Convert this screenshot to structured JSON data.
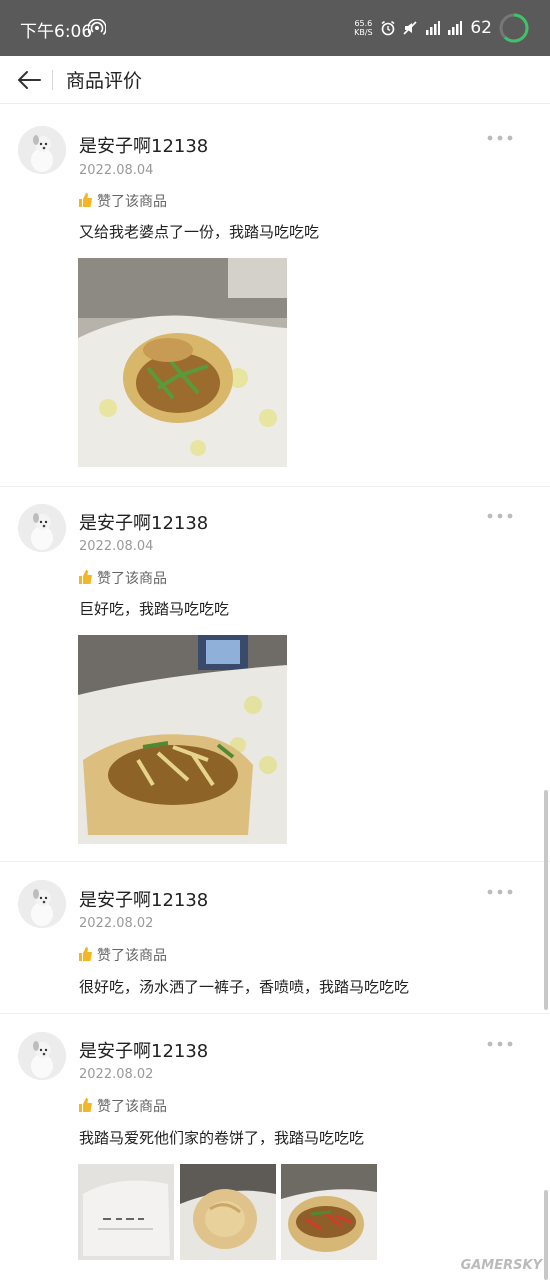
{
  "status_bar": {
    "time": "下午6:06",
    "net_speed_value": "65.6",
    "net_speed_unit": "KB/S",
    "battery": "62",
    "colors": {
      "bg": "#5a5a5a",
      "battery_ring": "#3ec26a"
    }
  },
  "header": {
    "title": "商品评价",
    "back_icon": "arrow-left-icon"
  },
  "reviews": [
    {
      "username": "是安子啊12138",
      "date": "2022.08.04",
      "like_label": "赞了该商品",
      "text": "又给我老婆点了一份，我踏马吃吃吃",
      "photos": 1
    },
    {
      "username": "是安子啊12138",
      "date": "2022.08.04",
      "like_label": "赞了该商品",
      "text": "巨好吃，我踏马吃吃吃",
      "photos": 1
    },
    {
      "username": "是安子啊12138",
      "date": "2022.08.02",
      "like_label": "赞了该商品",
      "text": "很好吃，汤水洒了一裤子，香喷喷，我踏马吃吃吃",
      "photos": 0
    },
    {
      "username": "是安子啊12138",
      "date": "2022.08.02",
      "like_label": "赞了该商品",
      "text": "我踏马爱死他们家的卷饼了，我踏马吃吃吃",
      "photos": 3
    }
  ],
  "watermark": "GAMERSKY",
  "accent_colors": {
    "thumb": "#f5b623",
    "meta_text": "#9a9a9a"
  }
}
